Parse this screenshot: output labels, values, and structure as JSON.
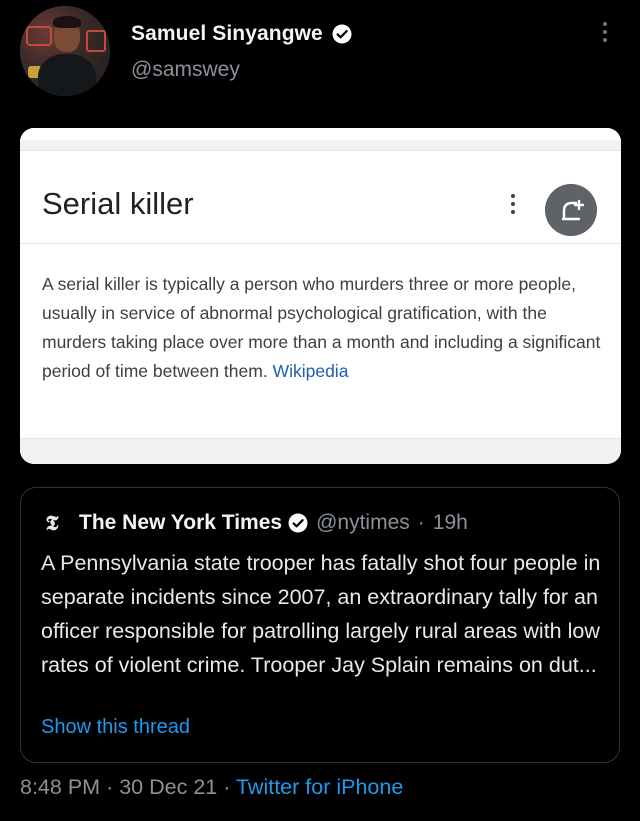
{
  "author": {
    "display_name": "Samuel Sinyangwe",
    "handle": "@samswey",
    "verified": true
  },
  "embedded_image": {
    "title": "Serial killer",
    "description": "A serial killer is typically a person who murders three or more people, usually in service of abnormal psychological gratification, with the murders taking place over more than a month and including a significant period of time between them.",
    "source_link": "Wikipedia",
    "icons": [
      "more-vert-icon",
      "share-icon"
    ]
  },
  "quoted_tweet": {
    "display_name": "The New York Times",
    "handle": "@nytimes",
    "separator": "·",
    "time": "19h",
    "text": "A Pennsylvania state trooper has fatally shot four people in separate incidents since 2007, an extraordinary tally for an officer responsible for patrolling largely rural areas with low rates of violent crime. Trooper Jay Splain remains on dut...",
    "show_thread": "Show this thread"
  },
  "footer": {
    "time": "8:48 PM",
    "sep1": "·",
    "date": "30 Dec 21",
    "sep2": "·",
    "source": "Twitter for iPhone"
  },
  "colors": {
    "background": "#000000",
    "link": "#1d9bf0",
    "muted_text": "#8a9198",
    "wiki_link": "#1a5fb4"
  }
}
